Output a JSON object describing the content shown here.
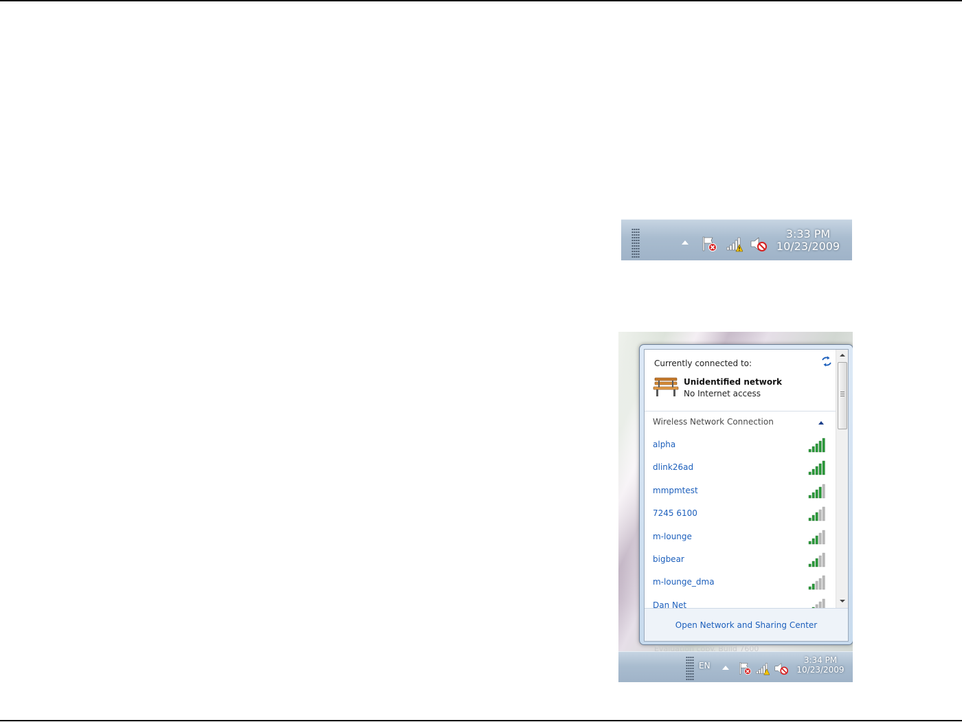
{
  "taskbar_1": {
    "time": "3:33 PM",
    "date": "10/23/2009",
    "icons": [
      "tray-arrow-icon",
      "action-center-flag-icon",
      "network-warning-icon",
      "volume-muted-icon"
    ]
  },
  "network_flyout": {
    "connected_label": "Currently connected to:",
    "current_network": {
      "name": "Unidentified network",
      "status": "No Internet access",
      "icon": "bench-icon"
    },
    "section_title": "Wireless Network Connection",
    "networks": [
      {
        "ssid": "alpha",
        "bars": 5
      },
      {
        "ssid": "dlink26ad",
        "bars": 5
      },
      {
        "ssid": "mmpmtest",
        "bars": 4
      },
      {
        "ssid": "7245 6100",
        "bars": 3
      },
      {
        "ssid": "m-lounge",
        "bars": 3
      },
      {
        "ssid": "bigbear",
        "bars": 3
      },
      {
        "ssid": "m-lounge_dma",
        "bars": 2
      },
      {
        "ssid": "Dan Net",
        "bars": 2
      }
    ],
    "footer_link": "Open Network and Sharing Center",
    "background_text": "Evaluation copy. Build 7600"
  },
  "taskbar_2": {
    "language": "EN",
    "time": "3:34 PM",
    "date": "10/23/2009"
  },
  "colors": {
    "link": "#1c5fbc",
    "signal_on": "#2b9a3a",
    "signal_off": "#b9b9b9",
    "warning": "#f2c200",
    "error": "#d51f1f"
  }
}
